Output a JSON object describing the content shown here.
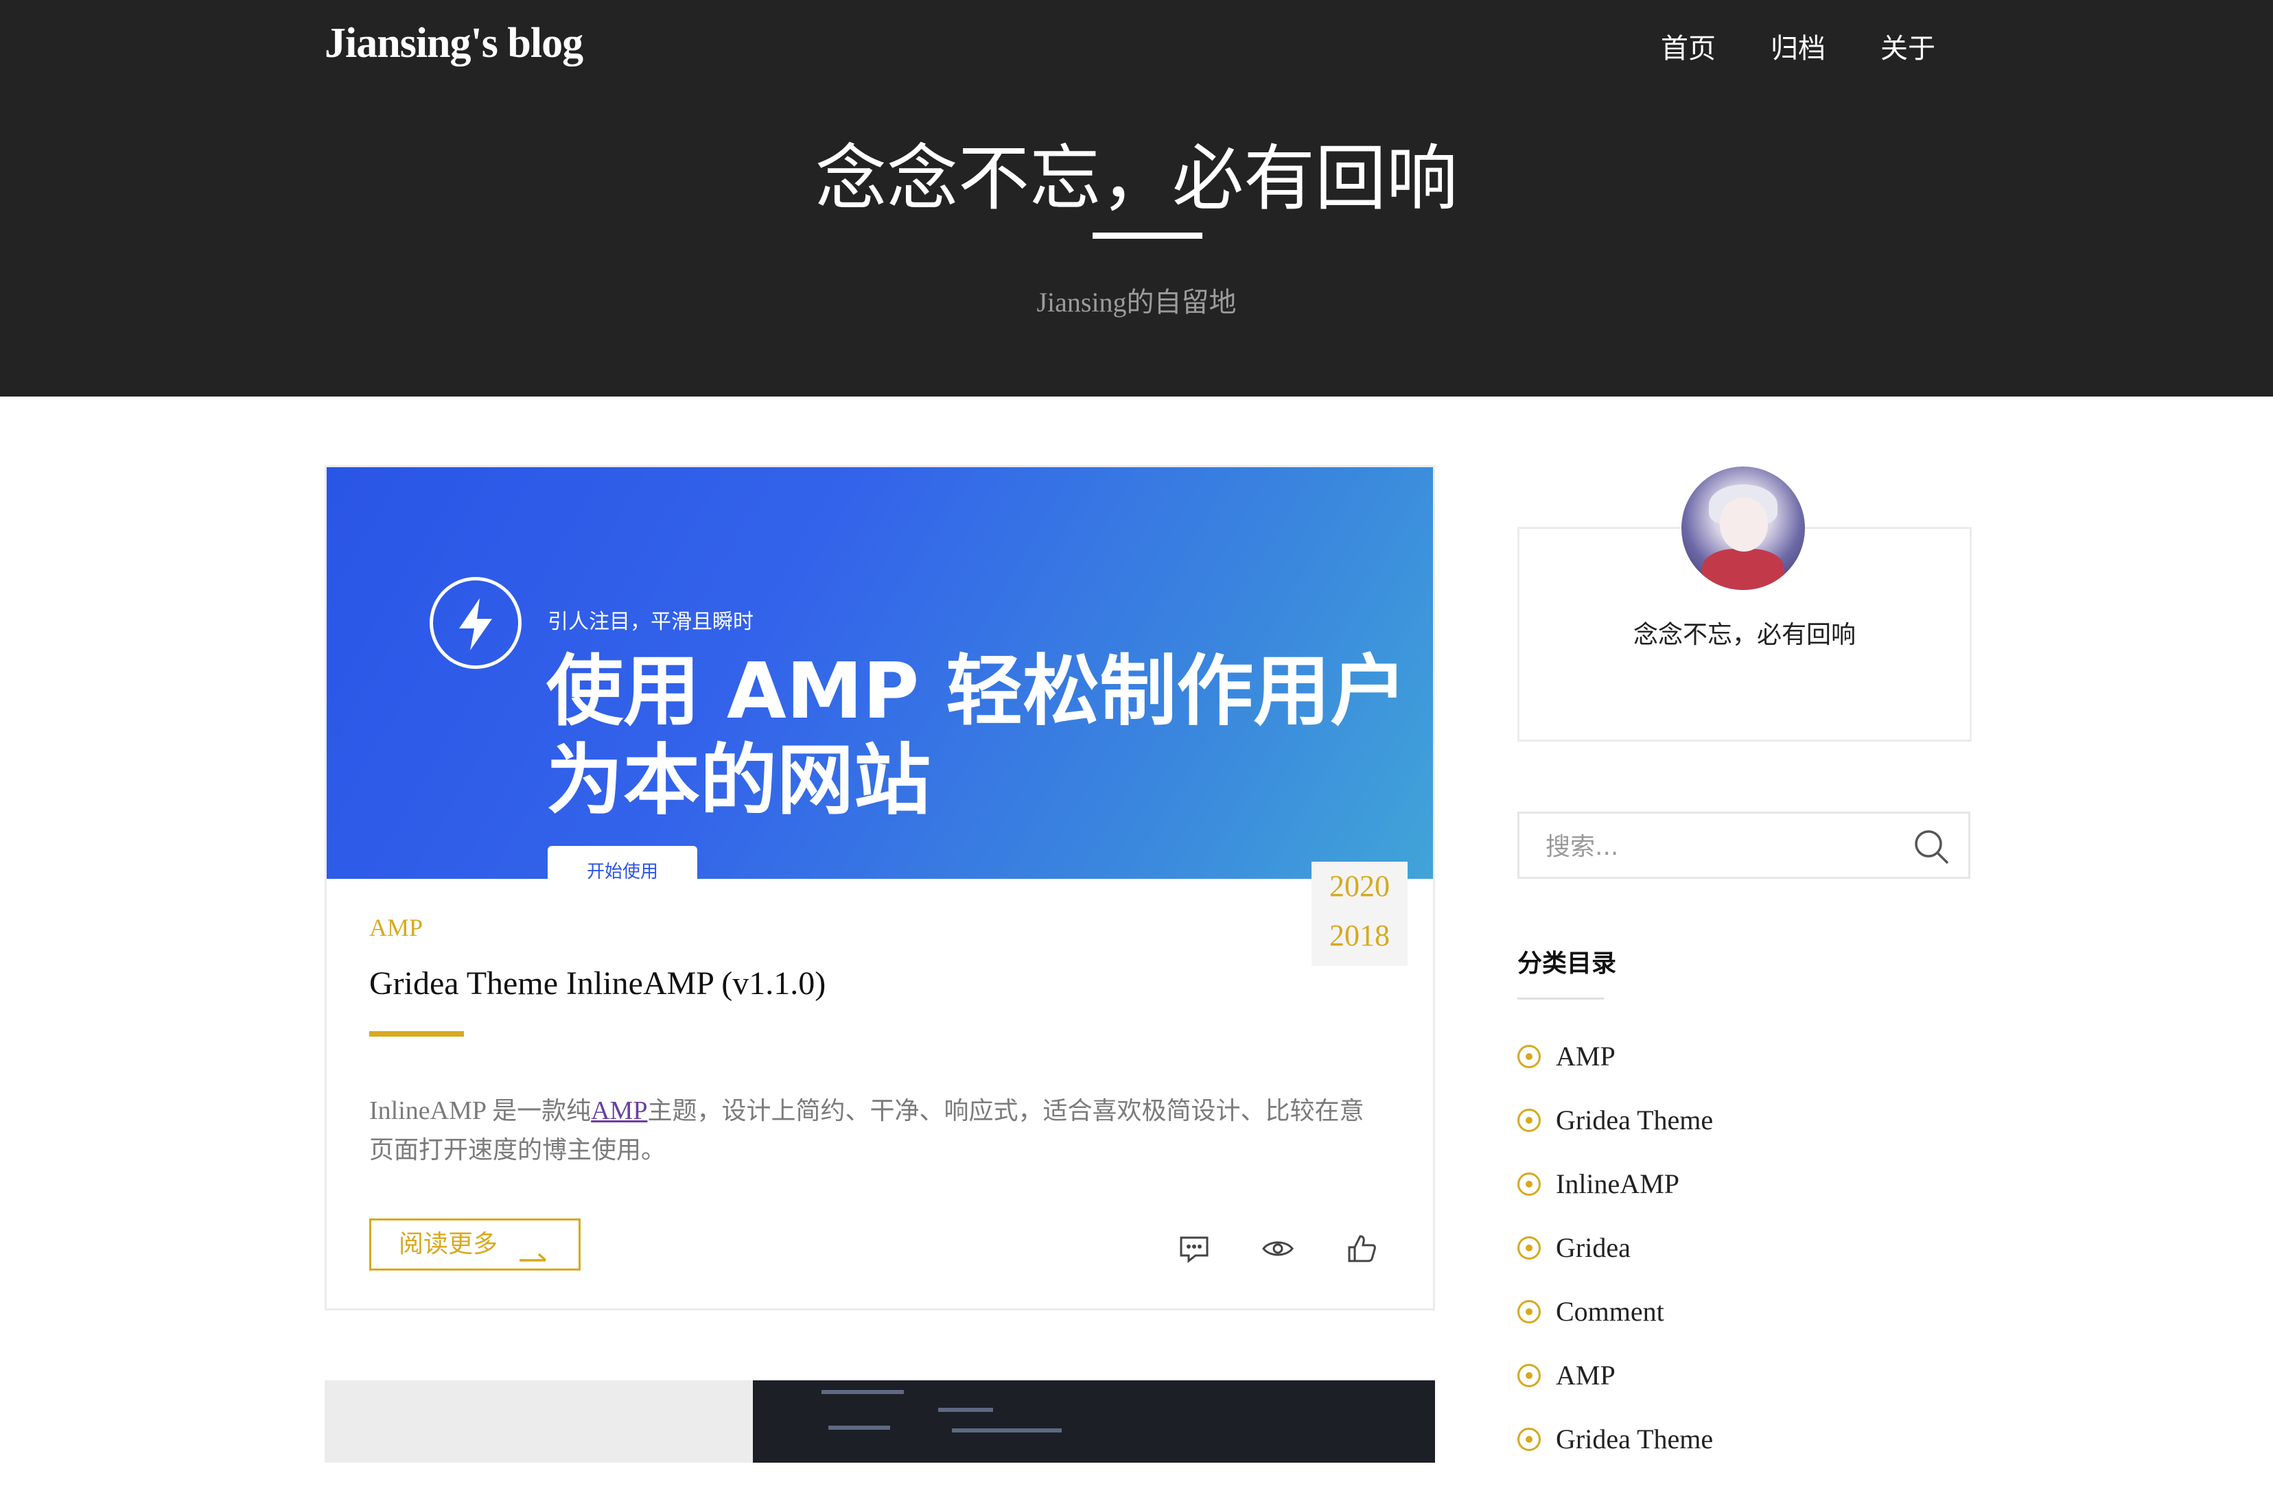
{
  "header": {
    "site_title": "Jiansing's blog",
    "nav": [
      "首页",
      "归档",
      "关于"
    ],
    "hero_title": "念念不忘，必有回响",
    "hero_subtitle": "Jiansing的自留地"
  },
  "post": {
    "thumbnail": {
      "tagline": "引人注目，平滑且瞬时",
      "headline": "使用 AMP 轻松制作用户为本的网站",
      "button": "开始使用",
      "icon": "bolt-icon"
    },
    "date": {
      "top": "2020",
      "bottom": "2018"
    },
    "category": "AMP",
    "title": "Gridea Theme InlineAMP (v1.1.0)",
    "excerpt": {
      "before": "InlineAMP ",
      "before_cn": "是一款纯",
      "link": "AMP",
      "after": "主题，设计上简约、干净、响应式，适合喜欢极简设计、比较在意页面打开速度的博主使用。"
    },
    "read_more": "阅读更多",
    "actions": [
      "comment-icon",
      "eye-icon",
      "thumbs-up-icon"
    ]
  },
  "sidebar": {
    "profile_text": "念念不忘，必有回响",
    "search_placeholder": "搜索...",
    "categories_heading": "分类目录",
    "categories": [
      "AMP",
      "Gridea Theme",
      "InlineAMP",
      "Gridea",
      "Comment",
      "AMP",
      "Gridea Theme"
    ]
  },
  "colors": {
    "accent": "#d7a91e",
    "header_bg": "#232323",
    "link": "#6b3fa0"
  }
}
